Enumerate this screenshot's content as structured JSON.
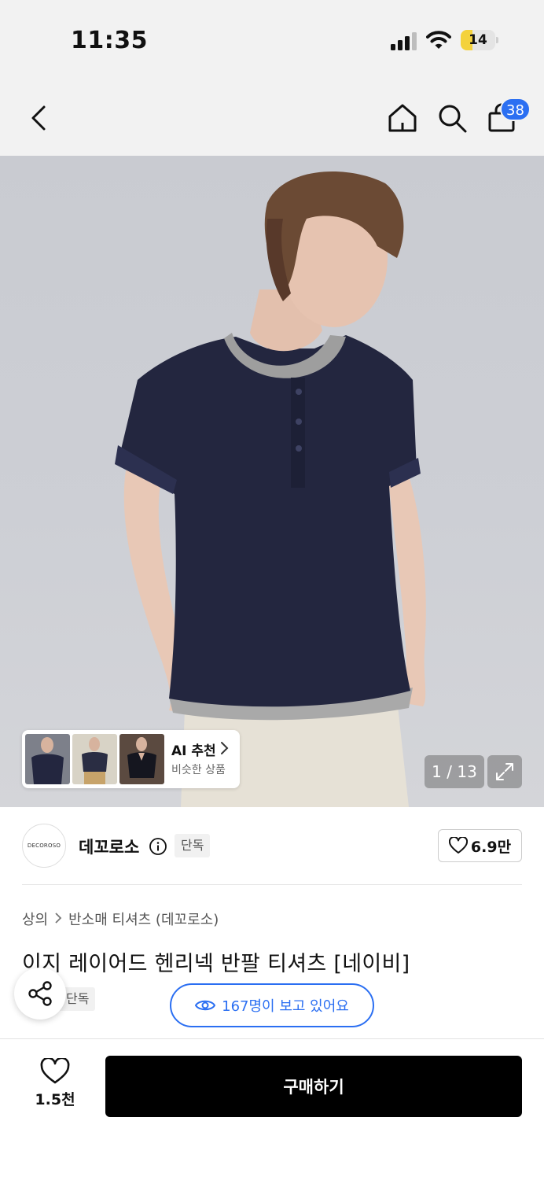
{
  "status_bar": {
    "time": "11:35",
    "battery_level": "14",
    "battery_fraction": 0.14
  },
  "nav": {
    "icons": [
      "back-icon",
      "home-icon",
      "search-icon",
      "cart-icon"
    ],
    "cart_count": "38",
    "badge_color": "#2b6ff2"
  },
  "hero": {
    "ai_title": "AI 추천",
    "ai_subtitle": "비슷한 상품",
    "page_counter": "1 / 13"
  },
  "brand": {
    "logo_text": "DECOROSO",
    "name": "데꼬로소",
    "tag": "단독",
    "like_count": "6.9만"
  },
  "product": {
    "breadcrumb": [
      "상의",
      "반소매 티셔츠 (데꼬로소)"
    ],
    "title": "이지 레이어드 헨리넥 반팔 티셔츠 [네이비]",
    "exclusive_tag": "단독",
    "viewers": "167명이 보고 있어요",
    "accent_color": "#2b6ff2"
  },
  "bottom_bar": {
    "wish_count": "1.5천",
    "buy_label": "구매하기"
  }
}
